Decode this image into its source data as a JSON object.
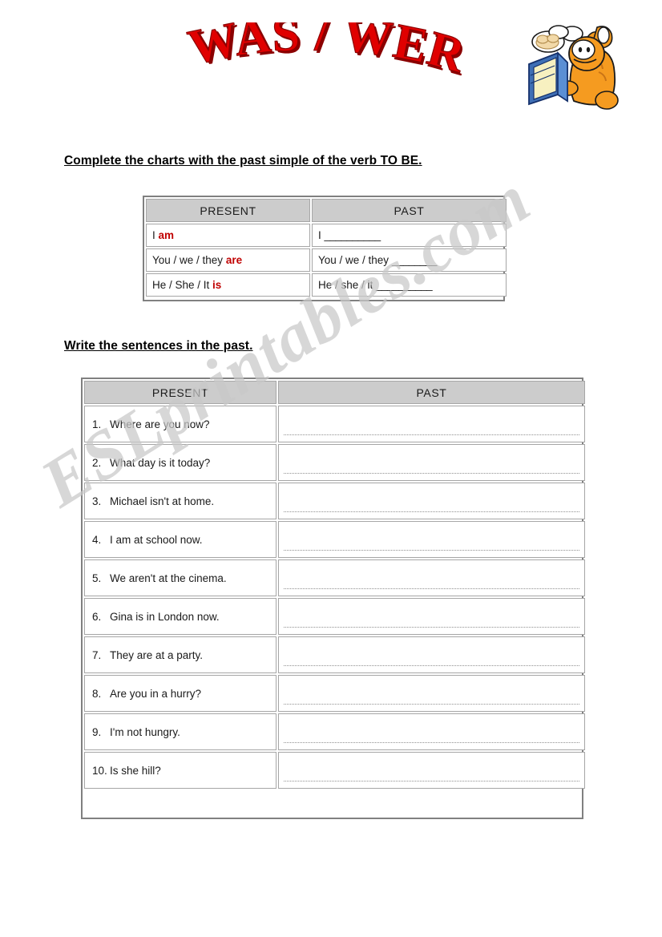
{
  "page": {
    "title_art": "WAS / WERE",
    "title_color": "#e00000",
    "title_shadow_color": "#8b0000",
    "watermark": "ESLprintables.com",
    "watermark_color": "#c9c9c9",
    "clipart_name": "garfield-reading-book"
  },
  "sections": [
    {
      "instruction": "Complete the charts with the past simple of the verb TO BE.",
      "table": {
        "headers": [
          "PRESENT",
          "PAST"
        ],
        "rows": [
          {
            "present_prefix": "I ",
            "present_verb": "am",
            "past_subject": "I ",
            "past_blank": "__________"
          },
          {
            "present_prefix": "You / we / they ",
            "present_verb": "are",
            "past_subject": "You / we / they ",
            "past_blank": "________"
          },
          {
            "present_prefix": "He / She / It  ",
            "present_verb": "is",
            "past_subject": "He / she / it ",
            "past_blank": "__________"
          }
        ]
      }
    },
    {
      "instruction": "Write the sentences in the past.",
      "table": {
        "headers": [
          "PRESENT",
          "PAST"
        ],
        "rows": [
          {
            "num": "1.",
            "present": "Where are you now?",
            "past": ""
          },
          {
            "num": "2.",
            "present": "What day is it today?",
            "past": ""
          },
          {
            "num": "3.",
            "present": "Michael isn't at home.",
            "past": ""
          },
          {
            "num": "4.",
            "present": "I am at school now.",
            "past": ""
          },
          {
            "num": "5.",
            "present": "We aren't at the cinema.",
            "past": ""
          },
          {
            "num": "6.",
            "present": "Gina is in London now.",
            "past": ""
          },
          {
            "num": "7.",
            "present": "They are at a party.",
            "past": ""
          },
          {
            "num": "8.",
            "present": "Are you in a hurry?",
            "past": ""
          },
          {
            "num": "9.",
            "present": "I'm not hungry.",
            "past": ""
          },
          {
            "num": "10.",
            "present": "Is she hill?",
            "past": ""
          }
        ]
      }
    }
  ]
}
